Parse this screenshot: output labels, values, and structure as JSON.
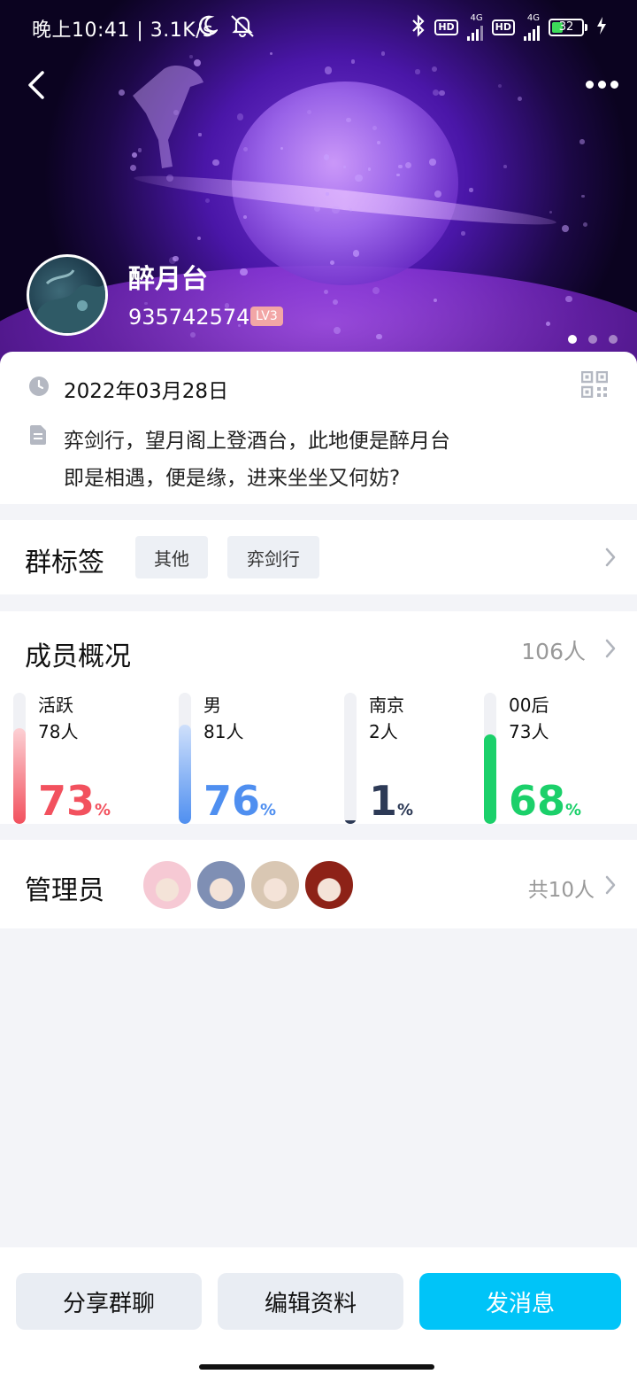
{
  "status_bar": {
    "time": "晚上10:41 | 3.1K/s",
    "hd1": "HD",
    "net1": "4G",
    "hd2": "HD",
    "net2": "4G",
    "battery": "32"
  },
  "group": {
    "name": "醉月台",
    "id": "935742574",
    "level": "LV3",
    "pager_count": 3,
    "pager_active": 0
  },
  "info": {
    "date": "2022年03月28日",
    "desc_line1": "弈剑行，望月阁上登酒台，此地便是醉月台",
    "desc_line2": "即是相遇，便是缘，进来坐坐又何妨?"
  },
  "tags": {
    "title": "群标签",
    "items": [
      "其他",
      "弈剑行"
    ]
  },
  "members": {
    "title": "成员概况",
    "total": "106人",
    "stats": [
      {
        "label": "活跃",
        "count": "78人",
        "percent": "73",
        "ratio": 0.73,
        "color": "#f2515e",
        "bar_color_top": "#fcd0d4"
      },
      {
        "label": "男",
        "count": "81人",
        "percent": "76",
        "ratio": 0.76,
        "color": "#4f8ff0",
        "bar_color_top": "#cfe0fb"
      },
      {
        "label": "南京",
        "count": "2人",
        "percent": "1",
        "ratio": 0.01,
        "color": "#2d3a56",
        "bar_color_top": "#2d3a56"
      },
      {
        "label": "00后",
        "count": "73人",
        "percent": "68",
        "ratio": 0.68,
        "color": "#1bd06a",
        "bar_color_top": "#1bd06a"
      }
    ],
    "percent_sign": "%"
  },
  "admins": {
    "title": "管理员",
    "total": "共10人",
    "avatar_colors": [
      "#f6c9d4",
      "#7f8fb4",
      "#d9c7b3",
      "#8d2217"
    ]
  },
  "actions": {
    "share": "分享群聊",
    "edit": "编辑资料",
    "send": "发消息"
  },
  "colors": {
    "primary": "#00c4f8",
    "level_badge": "#f2a6a6"
  }
}
